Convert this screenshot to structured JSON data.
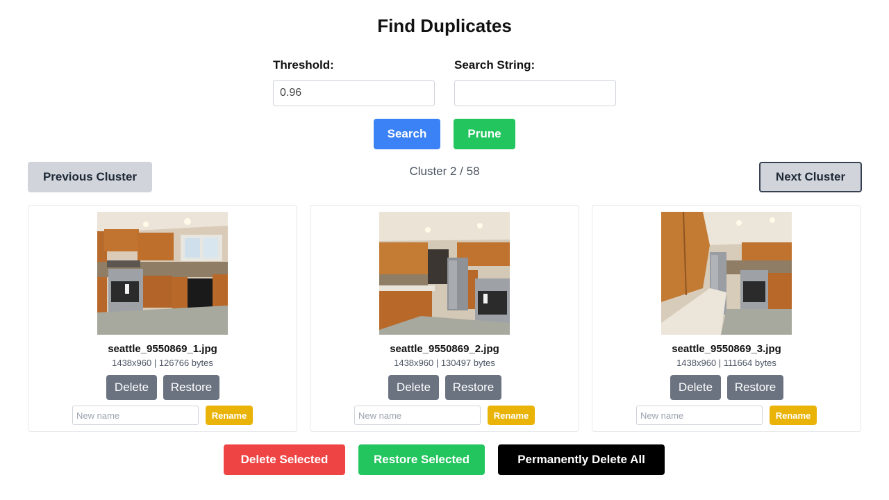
{
  "page": {
    "title": "Find Duplicates"
  },
  "controls": {
    "threshold_label": "Threshold:",
    "threshold_value": "0.96",
    "search_string_label": "Search String:",
    "search_string_value": "",
    "search_button": "Search",
    "prune_button": "Prune"
  },
  "navigation": {
    "prev_button": "Previous Cluster",
    "next_button": "Next Cluster",
    "cluster_counter": "Cluster 2 / 58"
  },
  "cards": [
    {
      "filename": "seattle_9550869_1.jpg",
      "meta": "1438x960 | 126766 bytes",
      "delete_label": "Delete",
      "restore_label": "Restore",
      "rename_placeholder": "New name",
      "rename_label": "Rename"
    },
    {
      "filename": "seattle_9550869_2.jpg",
      "meta": "1438x960 | 130497 bytes",
      "delete_label": "Delete",
      "restore_label": "Restore",
      "rename_placeholder": "New name",
      "rename_label": "Rename"
    },
    {
      "filename": "seattle_9550869_3.jpg",
      "meta": "1438x960 | 111664 bytes",
      "delete_label": "Delete",
      "restore_label": "Restore",
      "rename_placeholder": "New name",
      "rename_label": "Rename"
    }
  ],
  "bulk_actions": {
    "delete_selected": "Delete Selected",
    "restore_selected": "Restore Selected",
    "permanently_delete_all": "Permanently Delete All"
  },
  "colors": {
    "search": "#3b82f6",
    "prune": "#22c55e",
    "delete_selected": "#ef4444",
    "restore_selected": "#22c55e",
    "permanently_delete_all": "#000000",
    "rename": "#eab308",
    "card_action": "#6b7280"
  }
}
